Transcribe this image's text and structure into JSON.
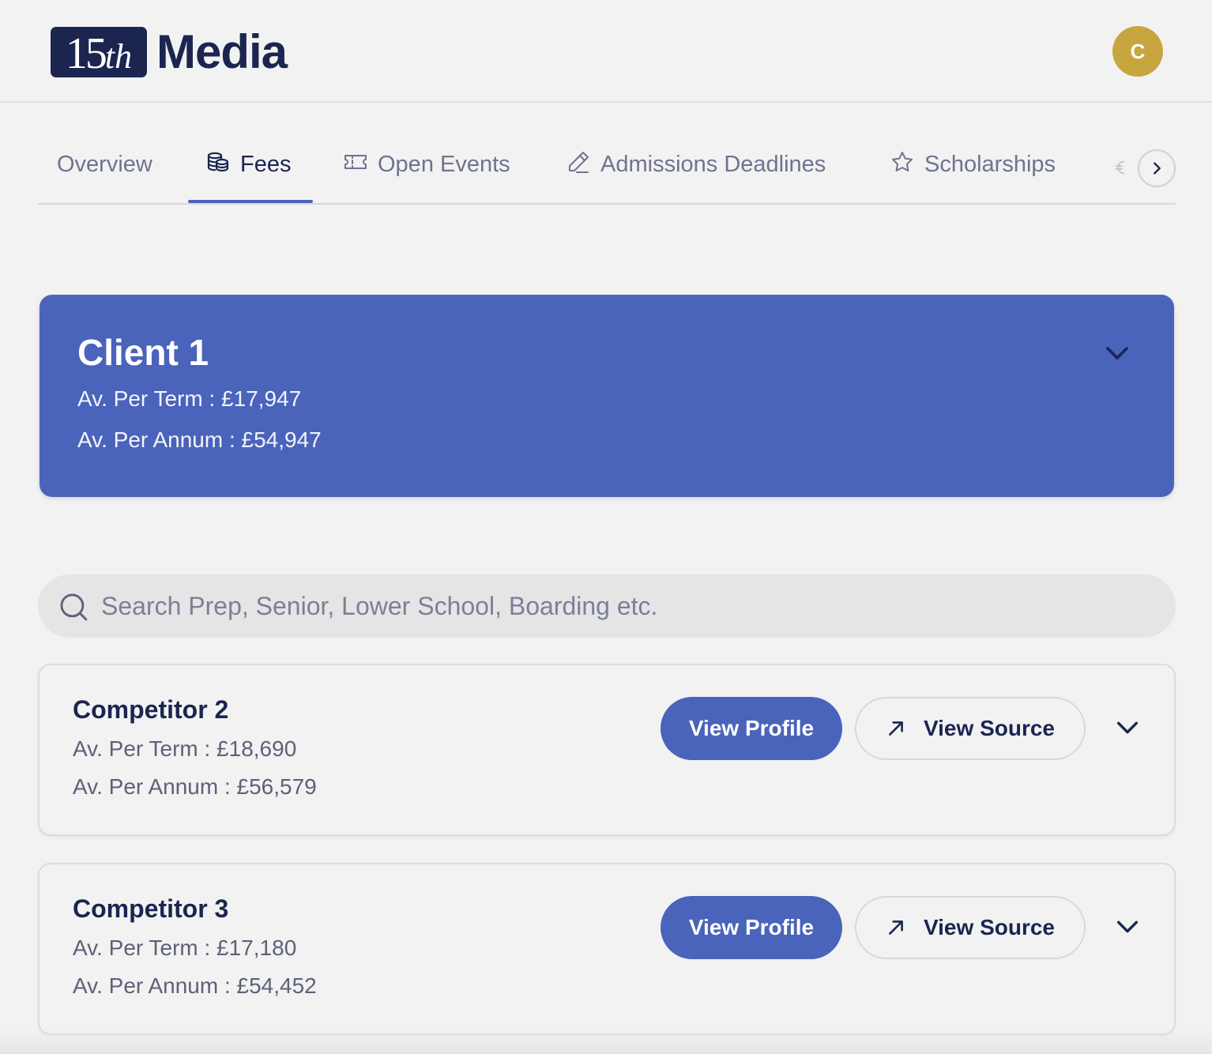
{
  "header": {
    "logo": {
      "number": "15",
      "suffix": "th",
      "word": "Media"
    },
    "avatar_initial": "C"
  },
  "tabs": [
    {
      "label": "Overview",
      "icon": "none",
      "active": false
    },
    {
      "label": "Fees",
      "icon": "coins-icon",
      "active": true
    },
    {
      "label": "Open Events",
      "icon": "ticket-icon",
      "active": false
    },
    {
      "label": "Admissions Deadlines",
      "icon": "pencil-icon",
      "active": false
    },
    {
      "label": "Scholarships",
      "icon": "star-icon",
      "active": false
    }
  ],
  "client": {
    "name": "Client 1",
    "per_term": "Av. Per Term : £17,947",
    "per_annum": "Av. Per Annum : £54,947"
  },
  "search": {
    "placeholder": "Search Prep, Senior, Lower School, Boarding etc.",
    "value": ""
  },
  "competitors": [
    {
      "name": "Competitor 2",
      "per_term": "Av. Per Term : £18,690",
      "per_annum": "Av. Per Annum : £56,579",
      "profile_label": "View Profile",
      "source_label": "View Source"
    },
    {
      "name": "Competitor 3",
      "per_term": "Av. Per Term : £17,180",
      "per_annum": "Av. Per Annum : £54,452",
      "profile_label": "View Profile",
      "source_label": "View Source"
    }
  ],
  "colors": {
    "brand_navy": "#1b2550",
    "accent_blue": "#4a63bb",
    "avatar_gold": "#c8a63f",
    "background": "#f2f2f2"
  }
}
